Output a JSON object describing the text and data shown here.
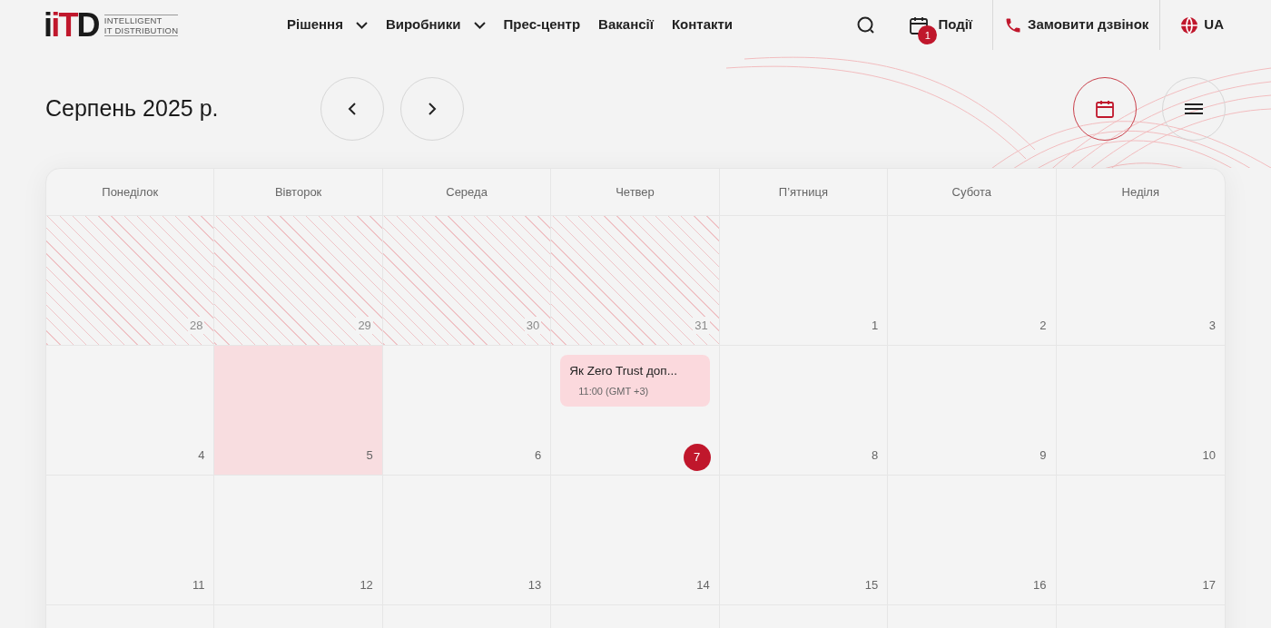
{
  "logo": {
    "letters": [
      {
        "text": "i",
        "color": "#1a1a1a"
      },
      {
        "text": "iT",
        "color": "#c0172c"
      },
      {
        "text": "D",
        "color": "#1a1a1a"
      }
    ],
    "tagline": [
      "INTELLIGENT",
      "IT DISTRIBUTION"
    ]
  },
  "nav": [
    {
      "label": "Рішення",
      "dropdown": true
    },
    {
      "label": "Виробники",
      "dropdown": true
    },
    {
      "label": "Прес-центр",
      "dropdown": false
    },
    {
      "label": "Вакансії",
      "dropdown": false
    },
    {
      "label": "Контакти",
      "dropdown": false
    }
  ],
  "events_link": {
    "label": "Події",
    "badge": "1"
  },
  "call_button": "Замовити дзвінок",
  "language": "UA",
  "calendar": {
    "title": "Серпень 2025 р.",
    "view_buttons": [
      {
        "kind": "calendar",
        "selected": true
      },
      {
        "kind": "list",
        "selected": false
      }
    ],
    "weekdays": [
      "Понеділок",
      "Вівторок",
      "Середа",
      "Четвер",
      "П’ятниця",
      "Субота",
      "Неділя"
    ],
    "weeks": [
      [
        {
          "day": "28",
          "kind": "outside",
          "today": false
        },
        {
          "day": "29",
          "kind": "outside",
          "today": false
        },
        {
          "day": "30",
          "kind": "outside",
          "today": false
        },
        {
          "day": "31",
          "kind": "outside",
          "today": false
        },
        {
          "day": "1",
          "kind": "normal",
          "today": false
        },
        {
          "day": "2",
          "kind": "normal",
          "today": false
        },
        {
          "day": "3",
          "kind": "normal",
          "today": false
        }
      ],
      [
        {
          "day": "4",
          "kind": "normal",
          "today": false
        },
        {
          "day": "5",
          "kind": "highlighted",
          "today": false
        },
        {
          "day": "6",
          "kind": "normal",
          "today": false
        },
        {
          "day": "7",
          "kind": "normal",
          "today": true,
          "events": [
            {
              "title": "Як Zero Trust доп...",
              "time": "11:00 (GMT +3)"
            }
          ]
        },
        {
          "day": "8",
          "kind": "normal",
          "today": false
        },
        {
          "day": "9",
          "kind": "normal",
          "today": false
        },
        {
          "day": "10",
          "kind": "normal",
          "today": false
        }
      ],
      [
        {
          "day": "11",
          "kind": "normal",
          "today": false
        },
        {
          "day": "12",
          "kind": "normal",
          "today": false
        },
        {
          "day": "13",
          "kind": "normal",
          "today": false
        },
        {
          "day": "14",
          "kind": "normal",
          "today": false
        },
        {
          "day": "15",
          "kind": "normal",
          "today": false
        },
        {
          "day": "16",
          "kind": "normal",
          "today": false
        },
        {
          "day": "17",
          "kind": "normal",
          "today": false
        }
      ]
    ]
  }
}
